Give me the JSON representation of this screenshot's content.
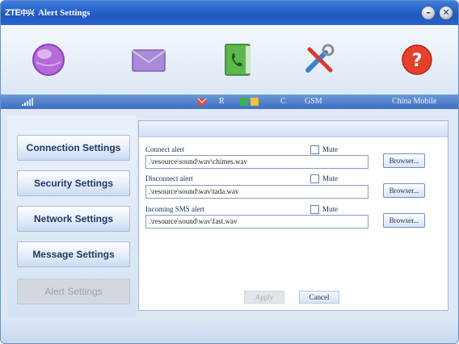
{
  "window": {
    "title": "Alert Settings",
    "logo_brand": "ZTE",
    "logo_cn": "中兴",
    "minimize_glyph": "–",
    "close_glyph": "✕"
  },
  "toolbar": {
    "items": [
      {
        "icon": "internet-globe-icon"
      },
      {
        "icon": "sms-envelope-icon"
      },
      {
        "icon": "phonebook-icon"
      },
      {
        "icon": "settings-tools-icon"
      },
      {
        "icon": "help-icon"
      }
    ],
    "help_glyph": "?"
  },
  "status": {
    "roaming": "R",
    "network_type_c": "C",
    "network": "GSM",
    "operator": "China Mobile"
  },
  "nav": {
    "items": [
      {
        "label": "Connection Settings"
      },
      {
        "label": "Security Settings"
      },
      {
        "label": "Network Settings"
      },
      {
        "label": "Message Settings"
      },
      {
        "label": "Alert Settings",
        "disabled": true
      }
    ]
  },
  "alerts": {
    "mute_label": "Mute",
    "browse_label": "Browser...",
    "fields": [
      {
        "label": "Connect alert",
        "path": ".\\resource\\sound\\wav\\chimes.wav"
      },
      {
        "label": "Disconnect alert",
        "path": ".\\resource\\sound\\wav\\tada.wav"
      },
      {
        "label": "Incoming SMS alert",
        "path": ".\\resource\\sound\\wav\\fast.wav"
      }
    ]
  },
  "actions": {
    "apply": "Apply",
    "cancel": "Cancel"
  },
  "colors": {
    "titlebar": "#1f57c0",
    "status_bar": "#3d6fc3",
    "panel_bg": "#dfe9f6"
  }
}
